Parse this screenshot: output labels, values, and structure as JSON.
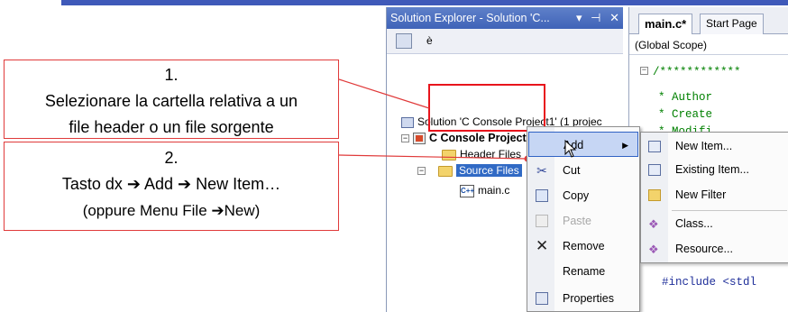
{
  "callouts": {
    "step1": {
      "number": "1.",
      "line1": "Selezionare la cartella relativa a un",
      "line2": "file header o un file sorgente"
    },
    "step2": {
      "number": "2.",
      "line1": "Tasto dx ➔ Add ➔ New Item…",
      "line2": "(oppure Menu File ➔New)"
    }
  },
  "solution_explorer": {
    "title": "Solution Explorer - Solution 'C...",
    "title_controls": [
      "▾",
      "⊣",
      "✕"
    ],
    "toolbar_text": "è",
    "tree": {
      "solution": "Solution 'C Console Project1' (1 projec",
      "project": "C Console Project1",
      "header_files": "Header Files",
      "source_files": "Source Files",
      "main_file": "main.c",
      "file_icon_text": "C++"
    }
  },
  "editor": {
    "tabs": [
      "main.c*",
      "Start Page"
    ],
    "scope": "(Global Scope)",
    "code_lines": [
      "/************",
      "*      Author",
      "*      Create",
      "*      Modifi",
      "#include <stdl"
    ]
  },
  "context_menu": {
    "items": [
      {
        "label": "Add",
        "has_submenu": true
      },
      {
        "label": "Cut"
      },
      {
        "label": "Copy"
      },
      {
        "label": "Paste",
        "disabled": true
      },
      {
        "label": "Remove"
      },
      {
        "label": "Rename"
      },
      {
        "label": "Properties"
      }
    ]
  },
  "add_submenu": {
    "items": [
      "New Item...",
      "Existing Item...",
      "New Filter",
      "Class...",
      "Resource..."
    ]
  },
  "colors": {
    "accent_bar": "#3f59b9",
    "callout_border": "#e03a3a",
    "selection": "#316ac5",
    "highlight_box": "#e8141c"
  }
}
